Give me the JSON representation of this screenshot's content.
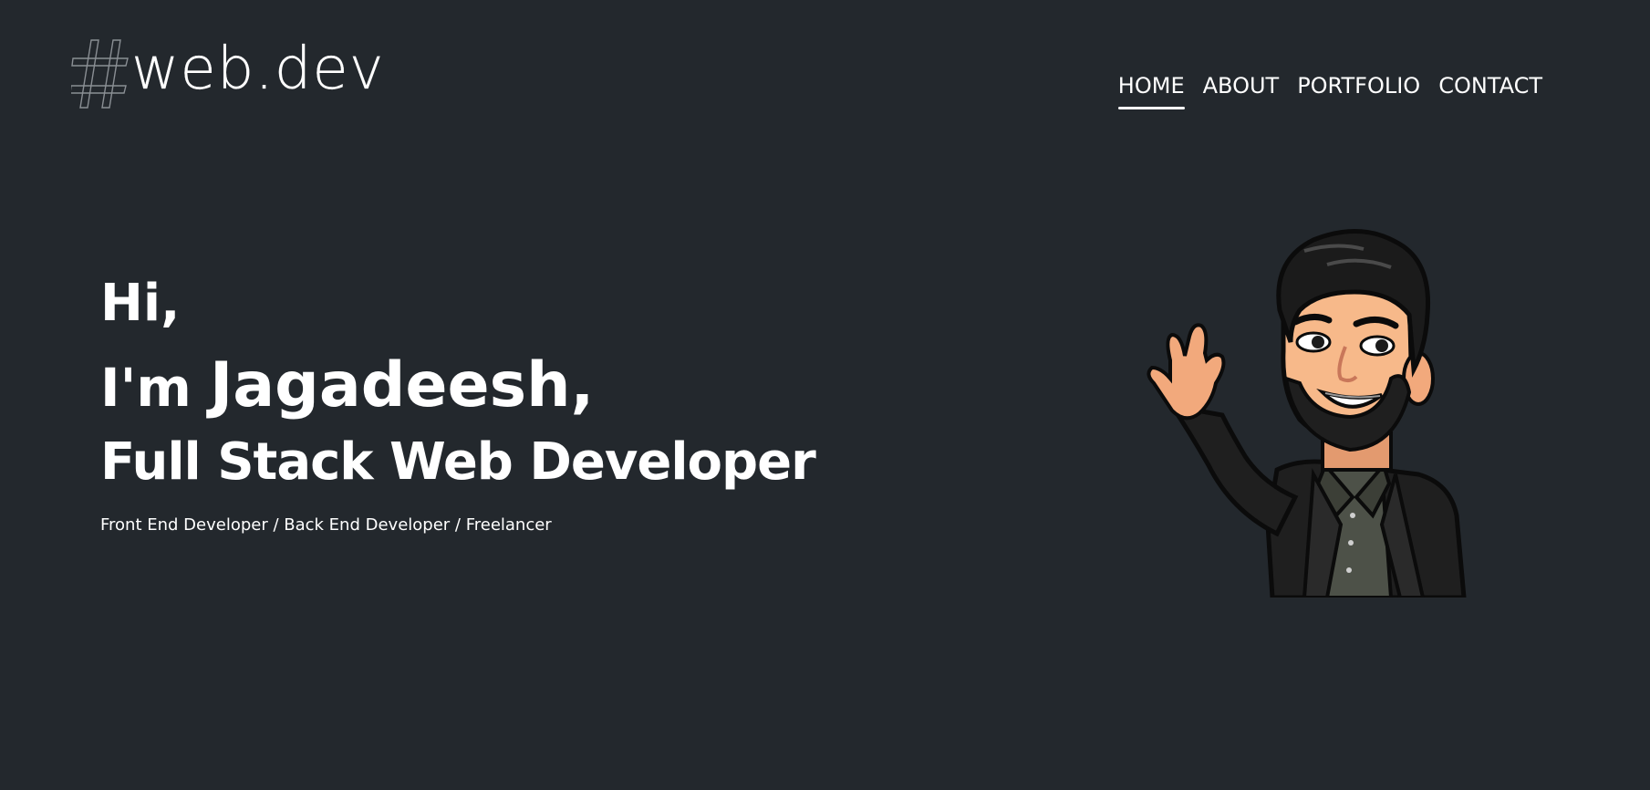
{
  "logo": {
    "hash": "#",
    "wordmark": "web.dev"
  },
  "nav": {
    "items": [
      {
        "label": "HOME",
        "active": true
      },
      {
        "label": "ABOUT",
        "active": false
      },
      {
        "label": "PORTFOLIO",
        "active": false
      },
      {
        "label": "CONTACT",
        "active": false
      }
    ]
  },
  "hero": {
    "greeting": "Hi,",
    "intro_prefix": "I'm",
    "name": "Jagadeesh,",
    "role": "Full Stack Web Developer",
    "subtitle": "Front End Developer / Back End Developer / Freelancer"
  },
  "avatar": {
    "icon": "waving-bitmoji-avatar"
  },
  "colors": {
    "background": "#23282d",
    "text": "#ffffff",
    "accent": "#ffffff"
  }
}
